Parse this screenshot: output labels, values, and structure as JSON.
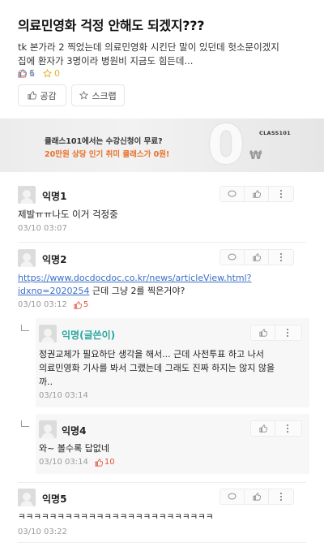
{
  "post": {
    "title": "의료민영화 걱정 안해도 되겠지???",
    "body_line1": "tk 본가라 2 찍었는데 의료민영화 시킨단 말이 있던데 헛소문이겠지",
    "body_line2": "집에 환자가 3명이라 병원비 지금도 힘든데...",
    "like_count": "1",
    "comment_count": "6",
    "scrap_count": "0",
    "empathy_label": "공감",
    "scrap_label": "스크랩"
  },
  "ad": {
    "line1": "클래스101에서는 수강신청이 무료?",
    "line2": "20만원 상당 인기 취미 클래스가 0원!",
    "brand": "CLASS101",
    "zero": "0",
    "won": "₩"
  },
  "comments": [
    {
      "nick": "익명1",
      "text": "제발ㅠㅠ나도 이거 걱정중",
      "time": "03/10 03:07"
    },
    {
      "nick": "익명2",
      "link_line1": "https://www.docdocdoc.co.kr/news/articleView.html?",
      "link_line2": "idxno=2020254",
      "text_after_link": " 근데 그냥 2를 찍은거야?",
      "time": "03/10 03:12",
      "likes": "5"
    },
    {
      "nick": "익명(글쓴이)",
      "text_line1": "정권교체가 필요하단 생각을 해서... 근데 사전투표 하고 나서",
      "text_line2": "의료민영화 기사를 봐서 그랬는데 그래도 진짜 하지는 않지 않을",
      "text_line3": "까..",
      "time": "03/10 03:14"
    },
    {
      "nick": "익명4",
      "text": "와~ 볼수록 답없네",
      "time": "03/10 03:14",
      "likes": "10"
    },
    {
      "nick": "익명5",
      "text": "ㅋㅋㅋㅋㅋㅋㅋㅋㅋㅋㅋㅋㅋㅋㅋㅋㅋㅋㅋㅋㅋㅋㅋㅋㅋ",
      "time": "03/10 03:22"
    }
  ],
  "colors": {
    "like": "#e0553b",
    "comment": "#4aa6df",
    "scrap": "#e6b12a",
    "author": "#2aa7a0",
    "link": "#3b6fc8"
  },
  "icons": {
    "like": "thumbs-up-icon",
    "comment": "speech-bubble-icon",
    "scrap": "star-icon",
    "reply": "reply-icon",
    "more": "more-vertical-icon"
  }
}
